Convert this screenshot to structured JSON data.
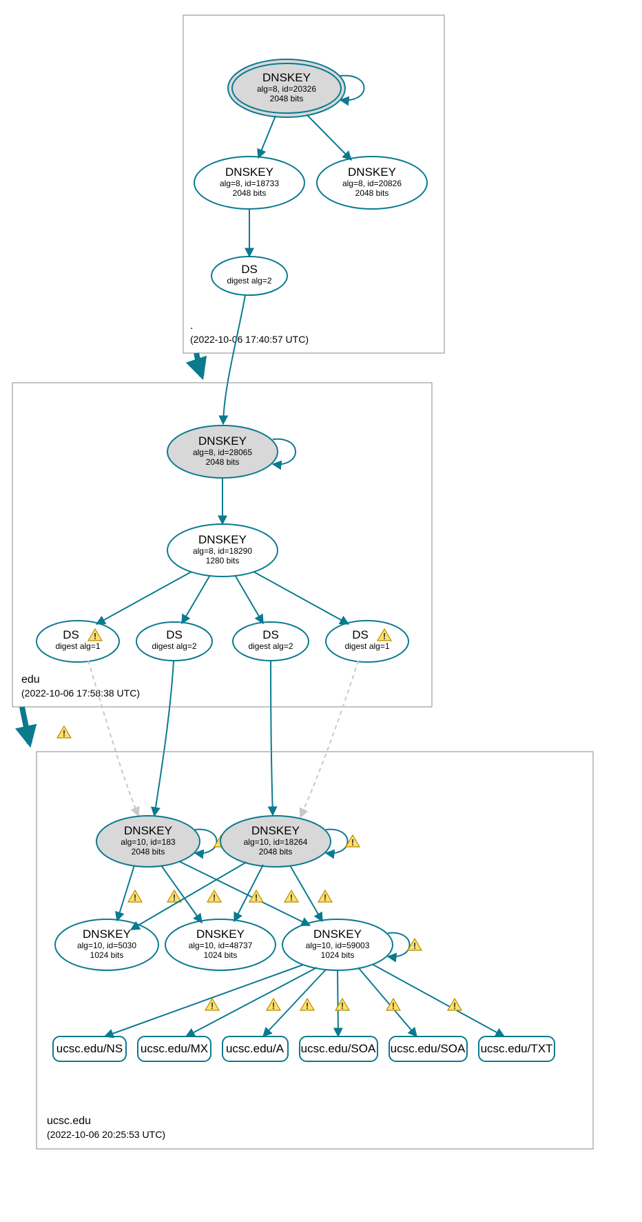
{
  "zones": {
    "root": {
      "name": ".",
      "timestamp": "(2022-10-06 17:40:57 UTC)"
    },
    "edu": {
      "name": "edu",
      "timestamp": "(2022-10-06 17:58:38 UTC)"
    },
    "ucsc": {
      "name": "ucsc.edu",
      "timestamp": "(2022-10-06 20:25:53 UTC)"
    }
  },
  "nodes": {
    "root_ksk": {
      "title": "DNSKEY",
      "line2": "alg=8, id=20326",
      "line3": "2048 bits"
    },
    "root_zsk1": {
      "title": "DNSKEY",
      "line2": "alg=8, id=18733",
      "line3": "2048 bits"
    },
    "root_zsk2": {
      "title": "DNSKEY",
      "line2": "alg=8, id=20826",
      "line3": "2048 bits"
    },
    "root_ds": {
      "title": "DS",
      "line2": "digest alg=2"
    },
    "edu_ksk": {
      "title": "DNSKEY",
      "line2": "alg=8, id=28065",
      "line3": "2048 bits"
    },
    "edu_zsk": {
      "title": "DNSKEY",
      "line2": "alg=8, id=18290",
      "line3": "1280 bits"
    },
    "edu_ds1": {
      "title": "DS",
      "line2": "digest alg=1"
    },
    "edu_ds2": {
      "title": "DS",
      "line2": "digest alg=2"
    },
    "edu_ds3": {
      "title": "DS",
      "line2": "digest alg=2"
    },
    "edu_ds4": {
      "title": "DS",
      "line2": "digest alg=1"
    },
    "ucsc_ksk1": {
      "title": "DNSKEY",
      "line2": "alg=10, id=183",
      "line3": "2048 bits"
    },
    "ucsc_ksk2": {
      "title": "DNSKEY",
      "line2": "alg=10, id=18264",
      "line3": "2048 bits"
    },
    "ucsc_zsk1": {
      "title": "DNSKEY",
      "line2": "alg=10, id=5030",
      "line3": "1024 bits"
    },
    "ucsc_zsk2": {
      "title": "DNSKEY",
      "line2": "alg=10, id=48737",
      "line3": "1024 bits"
    },
    "ucsc_zsk3": {
      "title": "DNSKEY",
      "line2": "alg=10, id=59003",
      "line3": "1024 bits"
    },
    "rr_ns": {
      "label": "ucsc.edu/NS"
    },
    "rr_mx": {
      "label": "ucsc.edu/MX"
    },
    "rr_a": {
      "label": "ucsc.edu/A"
    },
    "rr_soa1": {
      "label": "ucsc.edu/SOA"
    },
    "rr_soa2": {
      "label": "ucsc.edu/SOA"
    },
    "rr_txt": {
      "label": "ucsc.edu/TXT"
    }
  },
  "colors": {
    "edge": "#0a7a8f",
    "warn_fill": "#ffe169",
    "warn_stroke": "#b58900"
  }
}
